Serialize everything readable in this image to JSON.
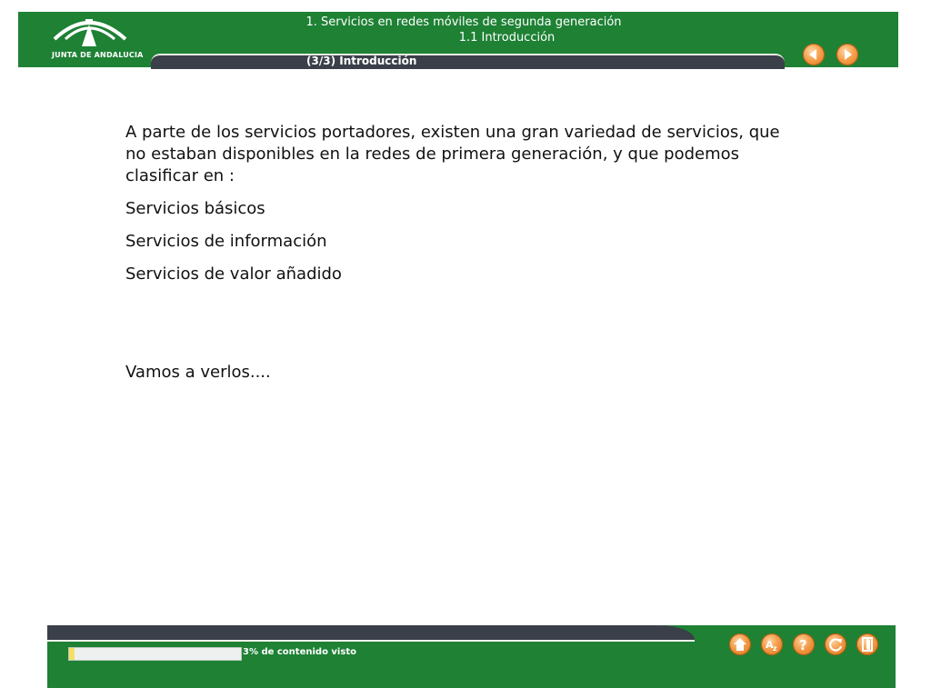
{
  "header": {
    "logo_text": "JUNTA DE ANDALUCIA",
    "title_line1": "1. Servicios en redes móviles de segunda generación",
    "title_line2": "1.1 Introducción",
    "page_label": "(3/3) Introducción"
  },
  "content": {
    "intro": "A parte de los servicios portadores, existen una gran variedad de servicios, que no estaban disponibles en la redes de primera generación, y que podemos clasificar en :",
    "items": [
      "Servicios básicos",
      "Servicios de información",
      "Servicios de valor añadido"
    ],
    "outro": "Vamos a verlos...."
  },
  "footer": {
    "progress_percent": 3,
    "progress_text": "3% de contenido visto",
    "tools": [
      "home-icon",
      "glossary-az-icon",
      "help-icon",
      "refresh-icon",
      "exit-icon"
    ]
  },
  "colors": {
    "header_green": "#1e8134",
    "strip_gray": "#3b3f49",
    "button_orange": "#f29a46",
    "progress_yellow": "#f3e063"
  }
}
